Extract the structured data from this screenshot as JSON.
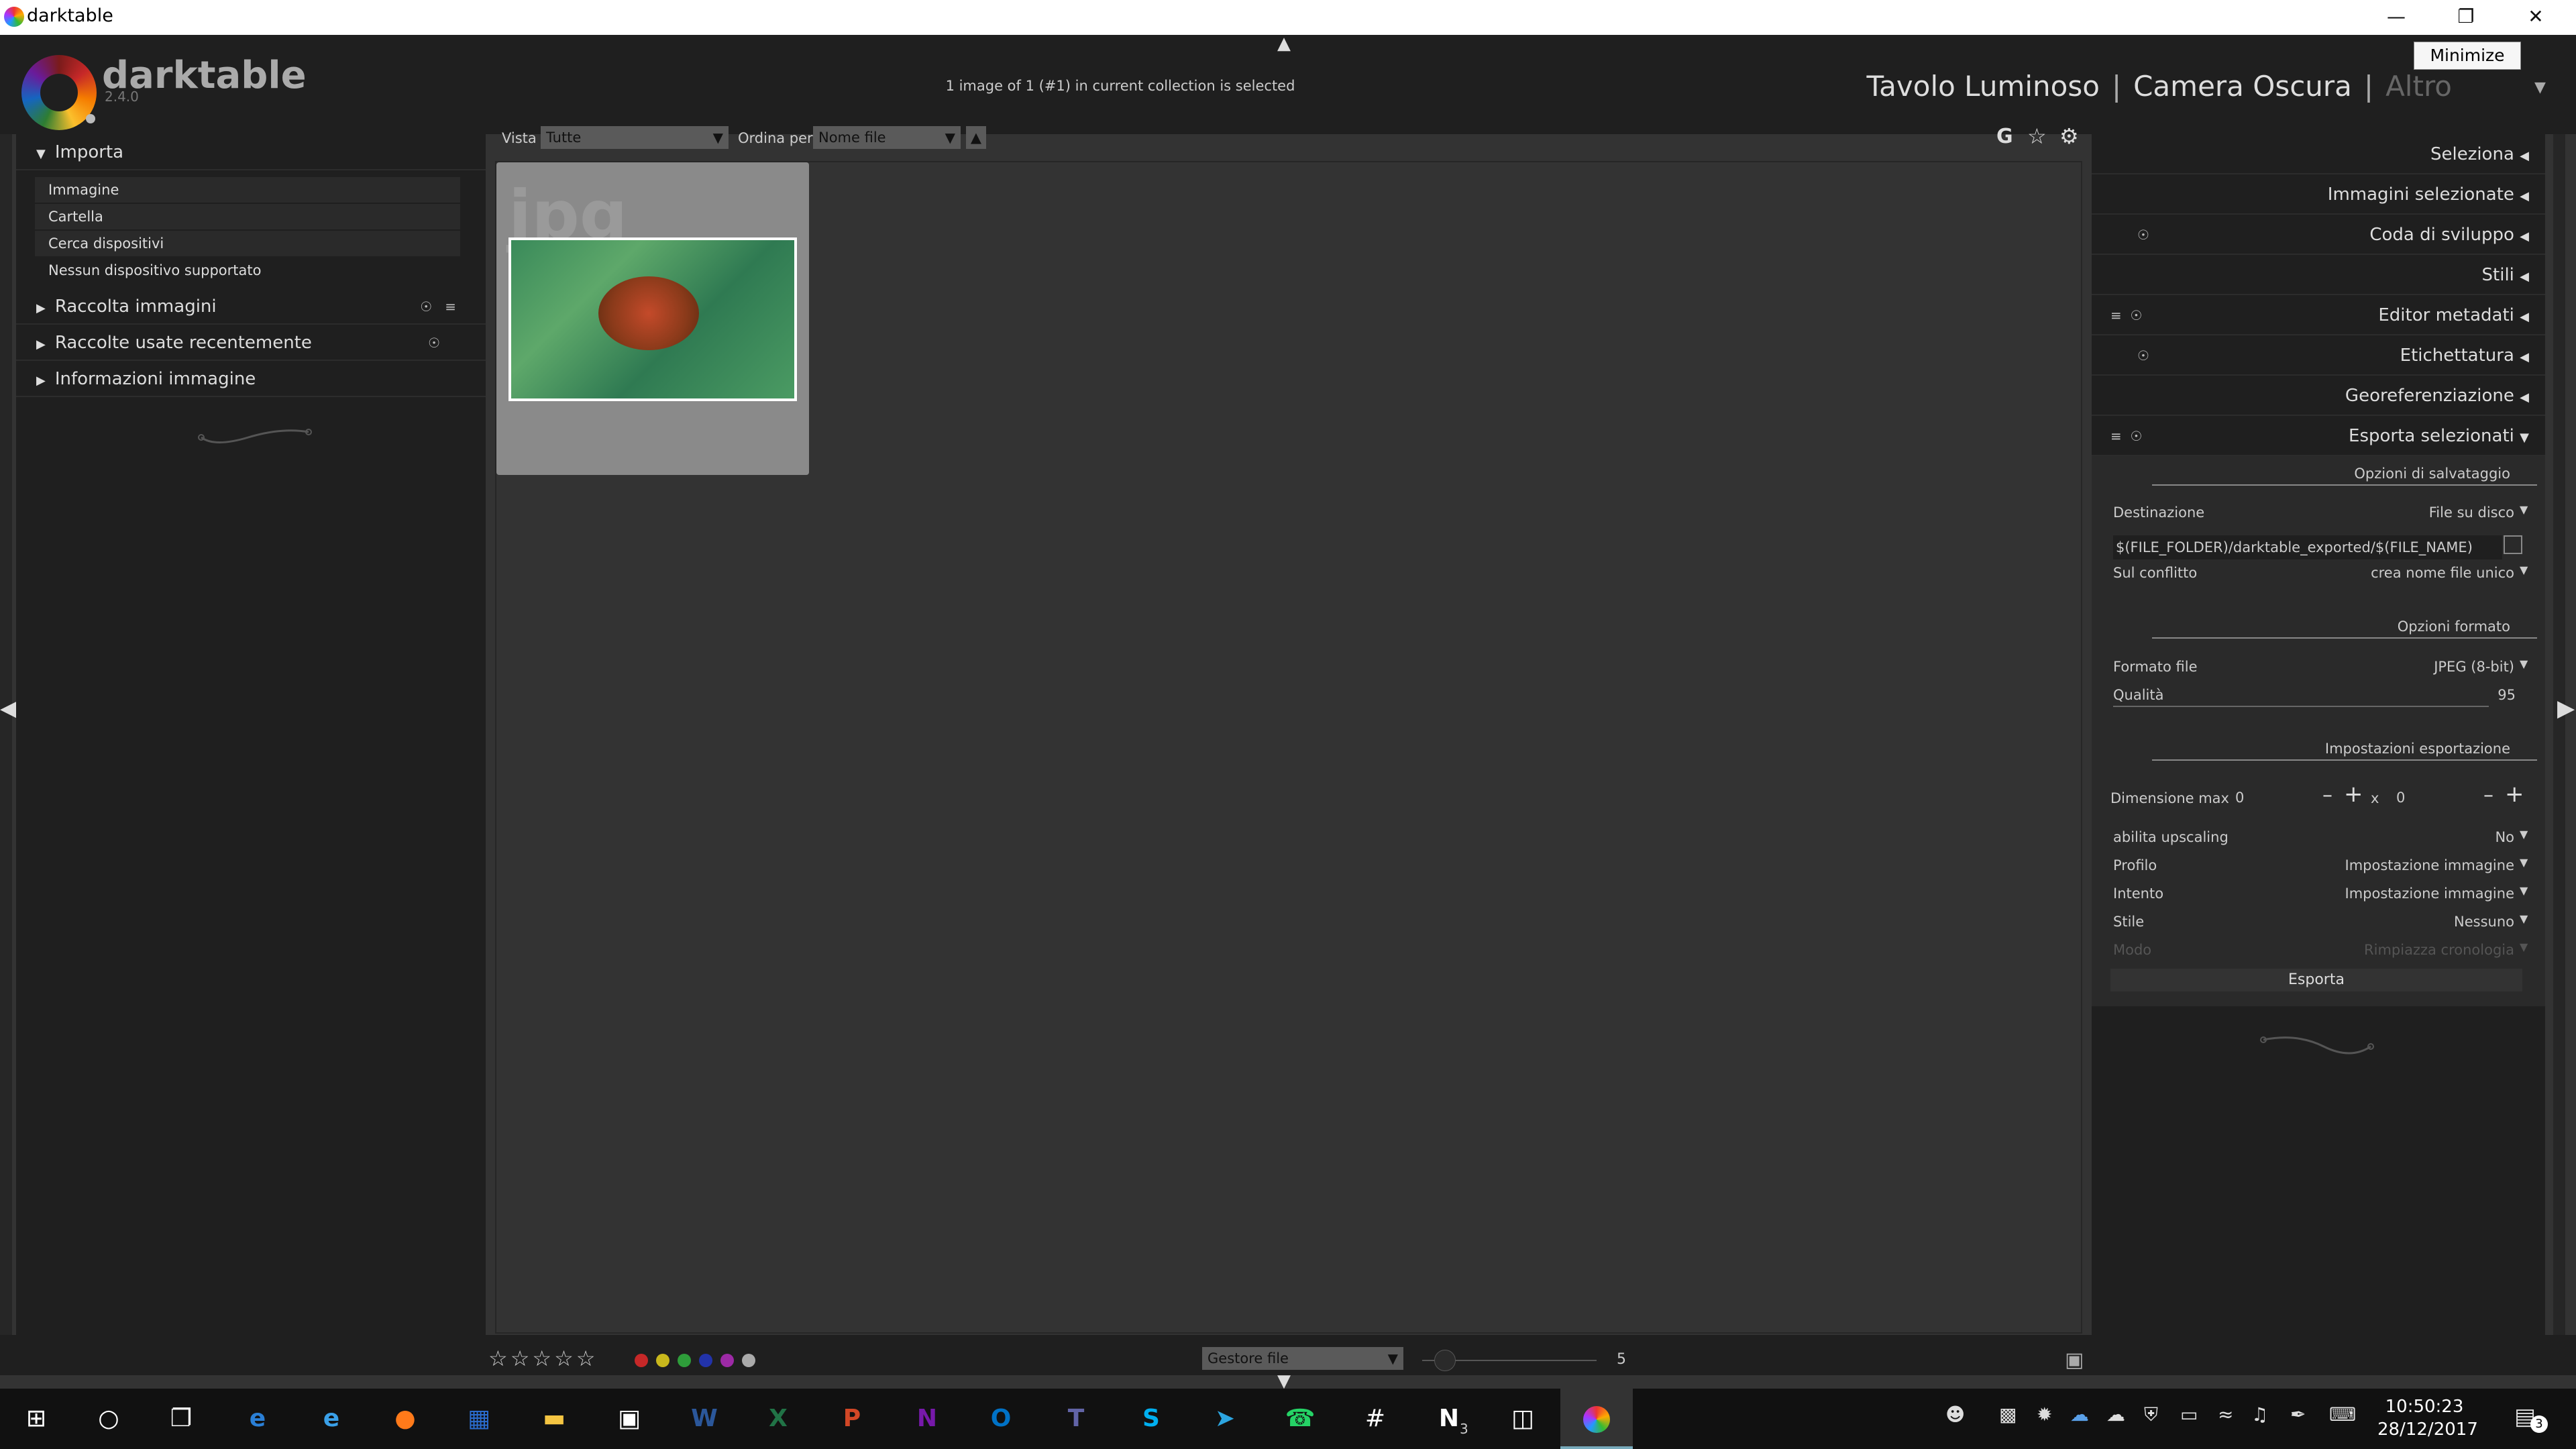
{
  "window": {
    "title": "darktable",
    "tooltip": "Minimize"
  },
  "header": {
    "brand": "darktable",
    "version": "2.4.0",
    "selection_info": "1 image of 1 (#1) in current collection is selected",
    "views": {
      "v1": "Tavolo Luminoso",
      "v2": "Camera Oscura",
      "v3": "Altro"
    }
  },
  "left": {
    "import_title": "Importa",
    "import_buttons": [
      "Immagine",
      "Cartella",
      "Cerca dispositivi",
      "Nessun dispositivo supportato"
    ],
    "modules": [
      "Raccolta immagini",
      "Raccolte usate recentemente",
      "Informazioni immagine"
    ]
  },
  "topbar": {
    "view_label": "Vista",
    "view_value": "Tutte",
    "sort_label": "Ordina per",
    "sort_value": "Nome file",
    "g_label": "G"
  },
  "thumb": {
    "ext": "jpg"
  },
  "right": {
    "modules": [
      "Seleziona",
      "Immagini selezionate",
      "Coda di sviluppo",
      "Stili",
      "Editor metadati",
      "Etichettatura",
      "Georeferenziazione",
      "Esporta selezionati"
    ],
    "export": {
      "sec_storage": "Opzioni di salvataggio",
      "dest_label": "Destinazione",
      "dest_value": "File su disco",
      "path": "$(FILE_FOLDER)/darktable_exported/$(FILE_NAME)",
      "conflict_label": "Sul conflitto",
      "conflict_value": "crea nome file unico",
      "sec_format": "Opzioni formato",
      "format_label": "Formato file",
      "format_value": "JPEG (8-bit)",
      "quality_label": "Qualità",
      "quality_value": "95",
      "sec_settings": "Impostazioni esportazione",
      "maxsize_label": "Dimensione max",
      "width": "0",
      "height": "0",
      "x": "x",
      "upscale_label": "abilita upscaling",
      "upscale_value": "No",
      "profile_label": "Profilo",
      "profile_value": "Impostazione immagine",
      "intent_label": "Intento",
      "intent_value": "Impostazione immagine",
      "style_label": "Stile",
      "style_value": "Nessuno",
      "mode_label": "Modo",
      "mode_value": "Rimpiazza cronologia",
      "export_button": "Esporta"
    }
  },
  "bottom": {
    "layout": "Gestore file",
    "zoom": "5"
  },
  "taskbar": {
    "time": "10:50:23",
    "date": "28/12/2017",
    "notif": "3",
    "onenote_badge": "3"
  },
  "colors": {
    "accent": "#1f1f1f",
    "panel": "#1f1f1f",
    "center": "#333333"
  }
}
